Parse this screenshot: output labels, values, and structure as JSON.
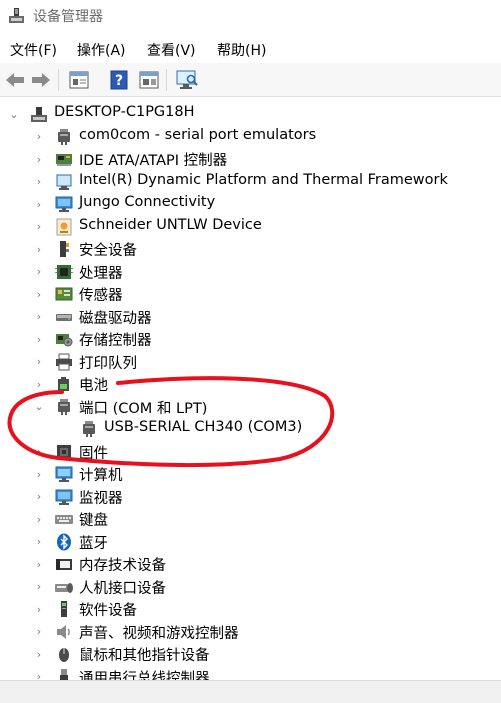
{
  "window": {
    "title": "设备管理器"
  },
  "menu": [
    {
      "label": "文件(F)"
    },
    {
      "label": "操作(A)"
    },
    {
      "label": "查看(V)"
    },
    {
      "label": "帮助(H)"
    }
  ],
  "toolbar": [
    {
      "icon": "back-arrow-icon"
    },
    {
      "icon": "forward-arrow-icon"
    },
    {
      "icon": "properties-icon"
    },
    {
      "icon": "help-icon"
    },
    {
      "icon": "view-icon"
    },
    {
      "icon": "scan-hardware-icon"
    }
  ],
  "tree": {
    "root": {
      "label": "DESKTOP-C1PG18H",
      "expanded": true
    },
    "items": [
      {
        "label": "com0com - serial port emulators",
        "icon": "port-icon"
      },
      {
        "label": "IDE ATA/ATAPI 控制器",
        "icon": "ide-controller-icon"
      },
      {
        "label": "Intel(R) Dynamic Platform and Thermal Framework",
        "icon": "system-device-icon"
      },
      {
        "label": "Jungo Connectivity",
        "icon": "monitor-icon"
      },
      {
        "label": "Schneider UNTLW Device",
        "icon": "schneider-device-icon"
      },
      {
        "label": "安全设备",
        "icon": "security-device-icon"
      },
      {
        "label": "处理器",
        "icon": "processor-icon"
      },
      {
        "label": "传感器",
        "icon": "sensor-icon"
      },
      {
        "label": "磁盘驱动器",
        "icon": "disk-drive-icon"
      },
      {
        "label": "存储控制器",
        "icon": "storage-controller-icon"
      },
      {
        "label": "打印队列",
        "icon": "printer-icon"
      },
      {
        "label": "电池",
        "icon": "battery-icon"
      },
      {
        "label": "端口 (COM 和 LPT)",
        "icon": "port-icon",
        "expanded": true,
        "children": [
          {
            "label": "USB-SERIAL CH340 (COM3)",
            "icon": "port-icon"
          }
        ]
      },
      {
        "label": "固件",
        "icon": "firmware-icon"
      },
      {
        "label": "计算机",
        "icon": "computer-icon"
      },
      {
        "label": "监视器",
        "icon": "monitor-icon"
      },
      {
        "label": "键盘",
        "icon": "keyboard-icon"
      },
      {
        "label": "蓝牙",
        "icon": "bluetooth-icon"
      },
      {
        "label": "内存技术设备",
        "icon": "memory-device-icon"
      },
      {
        "label": "人机接口设备",
        "icon": "hid-icon"
      },
      {
        "label": "软件设备",
        "icon": "software-device-icon"
      },
      {
        "label": "声音、视频和游戏控制器",
        "icon": "audio-icon"
      },
      {
        "label": "鼠标和其他指针设备",
        "icon": "mouse-icon"
      },
      {
        "label": "通用串行总线控制器",
        "icon": "usb-icon"
      }
    ]
  },
  "colors": {
    "annotation": "#e8101c",
    "selection": "#cce8ff",
    "toolbar_bg": "#f7f7f7"
  }
}
